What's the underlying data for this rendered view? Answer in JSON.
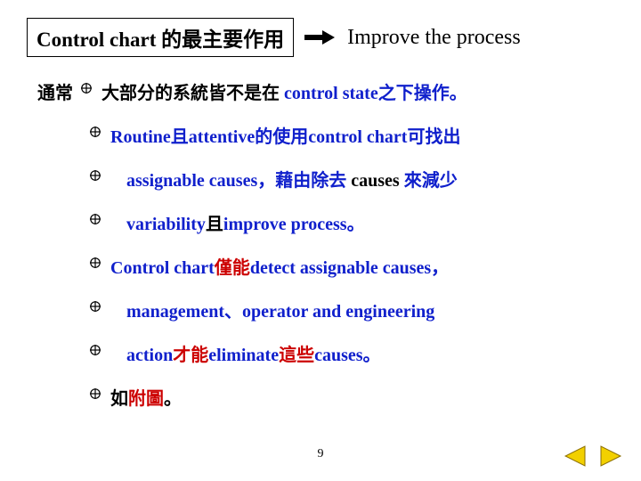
{
  "header": {
    "title_box": "Control chart 的最主要作用",
    "improve": "Improve the process"
  },
  "lines": [
    {
      "prefix": "通常",
      "indent": 0,
      "bullet_offset": 0,
      "parts": [
        {
          "text": "大部分的系統皆不是在 ",
          "cls": "text-black"
        },
        {
          "text": "control state之下操作。",
          "cls": "text-blue"
        }
      ]
    },
    {
      "indent": 1,
      "bullet_offset": 0,
      "parts": [
        {
          "text": "Routine且attentive的使用control chart可找出",
          "cls": "text-blue"
        }
      ]
    },
    {
      "indent": 2,
      "bullet_offset": 1,
      "parts": [
        {
          "text": "assignable causes，藉由除去 ",
          "cls": "text-blue"
        },
        {
          "text": "causes",
          "cls": "text-black"
        },
        {
          "text": "   來減少",
          "cls": "text-blue"
        }
      ]
    },
    {
      "indent": 2,
      "bullet_offset": 1,
      "parts": [
        {
          "text": "variability",
          "cls": "text-blue"
        },
        {
          "text": "且",
          "cls": "text-black"
        },
        {
          "text": "improve process。",
          "cls": "text-blue"
        }
      ]
    },
    {
      "indent": 1,
      "bullet_offset": 0,
      "parts": [
        {
          "text": "Control chart",
          "cls": "text-blue"
        },
        {
          "text": "僅能",
          "cls": "text-red"
        },
        {
          "text": "detect assignable causes，",
          "cls": "text-blue"
        }
      ]
    },
    {
      "indent": 2,
      "bullet_offset": 1,
      "parts": [
        {
          "text": "management、operator and engineering",
          "cls": "text-blue"
        }
      ]
    },
    {
      "indent": 2,
      "bullet_offset": 1,
      "parts": [
        {
          "text": "action",
          "cls": "text-blue"
        },
        {
          "text": "才能",
          "cls": "text-red"
        },
        {
          "text": "eliminate",
          "cls": "text-blue"
        },
        {
          "text": "這些",
          "cls": "text-red"
        },
        {
          "text": "causes。",
          "cls": "text-blue"
        }
      ]
    },
    {
      "indent": 1,
      "bullet_offset": 0,
      "parts": [
        {
          "text": "如",
          "cls": "text-black"
        },
        {
          "text": "附圖",
          "cls": "text-red"
        },
        {
          "text": "。",
          "cls": "text-black"
        }
      ]
    }
  ],
  "page_number": "9",
  "nav": {
    "prev": "prev",
    "next": "next"
  }
}
